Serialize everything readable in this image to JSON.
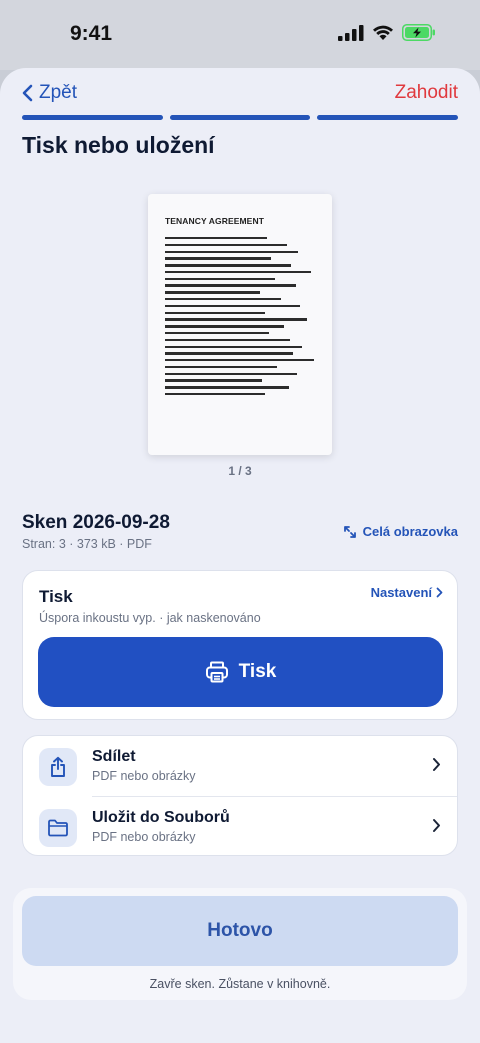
{
  "status_bar": {
    "time": "9:41"
  },
  "nav": {
    "back_label": "Zpět",
    "discard_label": "Zahodit"
  },
  "progress": {
    "segments": 3,
    "completed": 3
  },
  "page_title": "Tisk nebo uložení",
  "preview": {
    "doc_title": "TENANCY AGREEMENT",
    "page_indicator": "1 / 3"
  },
  "scan": {
    "name": "Sken 2026-09-28",
    "meta": "Stran: 3 · 373 kB · PDF",
    "fullscreen_label": "Celá obrazovka"
  },
  "print": {
    "title": "Tisk",
    "settings_label": "Nastavení",
    "subtitle": "Úspora inkoustu vyp. · jak naskenováno",
    "button_label": "Tisk"
  },
  "actions": [
    {
      "title": "Sdílet",
      "subtitle": "PDF nebo obrázky",
      "icon": "share-icon"
    },
    {
      "title": "Uložit do Souborů",
      "subtitle": "PDF nebo obrázky",
      "icon": "folder-icon"
    }
  ],
  "footer": {
    "done_label": "Hotovo",
    "note": "Zavře sken. Zůstane v knihovně."
  },
  "colors": {
    "accent": "#2150c2",
    "link": "#2454b8",
    "destructive": "#e0393e",
    "background": "#eceef7",
    "battery": "#4cd964"
  }
}
